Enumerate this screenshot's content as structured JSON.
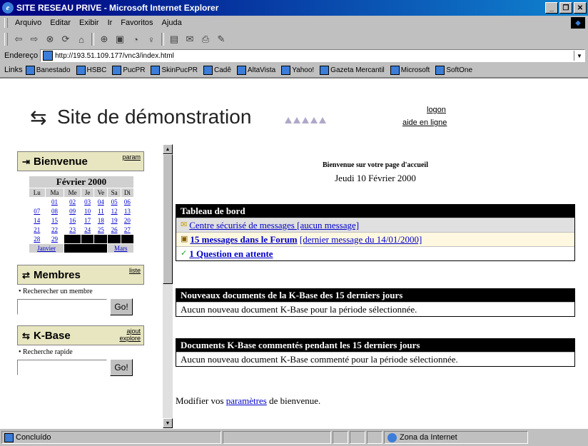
{
  "window": {
    "title": "SITE RESEAU PRIVE - Microsoft Internet Explorer",
    "buttons": [
      "_",
      "❐",
      "✕"
    ]
  },
  "menubar": {
    "items": [
      "Arquivo",
      "Editar",
      "Exibir",
      "Ir",
      "Favoritos",
      "Ajuda"
    ]
  },
  "toolbar": {
    "icons": [
      "back-icon",
      "forward-icon",
      "stop-icon",
      "refresh-icon",
      "home-icon",
      "search-icon",
      "favorites-icon",
      "history-icon",
      "channels-icon",
      "fullscreen-icon",
      "mail-icon",
      "print-icon",
      "edit-icon"
    ]
  },
  "address": {
    "label": "Endereço",
    "url": "http://193.51.109.177/vnc3/index.html"
  },
  "links": {
    "label": "Links",
    "items": [
      "Banestado",
      "HSBC",
      "PucPR",
      "SkinPucPR",
      "Cadê",
      "AltaVista",
      "Yahoo!",
      "Gazeta Mercantil",
      "Microsoft",
      "SoftOne"
    ]
  },
  "header": {
    "logo_icon": "⇆",
    "site_title": "Site de démonstration",
    "logon": "logon",
    "help": "aide en ligne"
  },
  "sidebar": {
    "bienvenue": {
      "icon": "⇥",
      "title": "Bienvenue",
      "link": "param"
    },
    "calendar": {
      "title": "Février 2000",
      "dow": [
        "Lu",
        "Ma",
        "Me",
        "Je",
        "Ve",
        "Sa",
        "Di"
      ],
      "weeks": [
        [
          "",
          "01",
          "02",
          "03",
          "04",
          "05",
          "06"
        ],
        [
          "07",
          "08",
          "09",
          "10",
          "11",
          "12",
          "13"
        ],
        [
          "14",
          "15",
          "16",
          "17",
          "18",
          "19",
          "20"
        ],
        [
          "21",
          "22",
          "23",
          "24",
          "25",
          "26",
          "27"
        ],
        [
          "28",
          "29",
          "",
          "",
          "",
          "",
          ""
        ]
      ],
      "prev": "Janvier",
      "next": "Mars"
    },
    "membres": {
      "icon": "⇄",
      "title": "Membres",
      "link": "liste",
      "bullet": "Recherecher un membre",
      "go": "Go!"
    },
    "kbase": {
      "icon": "⇆",
      "title": "K-Base",
      "link1": "ajout",
      "link2": "explore",
      "bullet": "Recherche rapide",
      "go": "Go!"
    }
  },
  "main": {
    "welcome": "Bienvenue sur votre page d'accueil",
    "date": "Jeudi 10 Février 2000",
    "dashboard": {
      "title": "Tableau de bord",
      "row1_link": "Centre sécurisé de messages [aucun message]",
      "row2_link": "15 messages dans le Forum",
      "row2_extra": "[dernier message du 14/01/2000]",
      "row3_link": "1 Question en attente"
    },
    "newdocs": {
      "title": "Nouveaux documents de la K-Base des 15 derniers jours",
      "text": "Aucun nouveau document K-Base pour la période sélectionnée."
    },
    "commented": {
      "title": "Documents K-Base commentés pendant les 15 derniers jours",
      "text": "Aucun nouveau document K-Base commenté pour la période sélectionnée."
    },
    "footer_before": "Modifier vos ",
    "footer_link": "paramètres",
    "footer_after": " de bienvenue."
  },
  "status": {
    "text": "Concluído",
    "zone": "Zona da Internet"
  }
}
